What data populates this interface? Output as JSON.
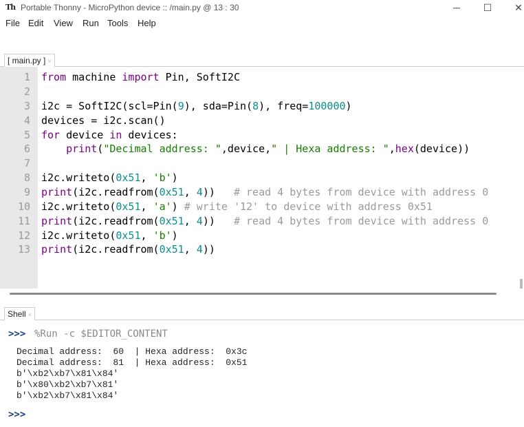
{
  "window": {
    "app_icon": "Th",
    "title": "Portable Thonny  -  MicroPython device :: /main.py  @  13 : 30",
    "minimize": "─",
    "maximize": "☐",
    "close": "✕"
  },
  "menu": [
    "File",
    "Edit",
    "View",
    "Run",
    "Tools",
    "Help"
  ],
  "editor_tab": {
    "label": "[ main.py ]",
    "close": "×"
  },
  "line_numbers": [
    "1",
    "2",
    "3",
    "4",
    "5",
    "6",
    "7",
    "8",
    "9",
    "10",
    "11",
    "12",
    "13"
  ],
  "code": {
    "l1": {
      "kw1": "from",
      "t1": " machine ",
      "kw2": "import",
      "t2": " Pin, SoftI2C"
    },
    "l3": {
      "t1": "i2c = SoftI2C(scl=Pin(",
      "n1": "9",
      "t2": "), sda=Pin(",
      "n2": "8",
      "t3": "), freq=",
      "n3": "100000",
      "t4": ")"
    },
    "l4": {
      "t1": "devices = i2c.scan()"
    },
    "l5": {
      "kw1": "for",
      "t1": " device ",
      "kw2": "in",
      "t2": " devices:"
    },
    "l6": {
      "indent": "    ",
      "kw1": "print",
      "t1": "(",
      "s1": "\"Decimal address: \"",
      "t2": ",device,",
      "s2": "\" | Hexa address: \"",
      "t3": ",",
      "kw2": "hex",
      "t4": "(device))"
    },
    "l8": {
      "t1": "i2c.writeto(",
      "n1": "0x51",
      "t2": ", ",
      "s1": "'b'",
      "t3": ")"
    },
    "l9": {
      "kw1": "print",
      "t1": "(i2c.readfrom(",
      "n1": "0x51",
      "t2": ", ",
      "n2": "4",
      "t3": "))   ",
      "c1": "# read 4 bytes from device with address 0"
    },
    "l10": {
      "t1": "i2c.writeto(",
      "n1": "0x51",
      "t2": ", ",
      "s1": "'a'",
      "t3": ") ",
      "c1": "# write '12' to device with address 0x51"
    },
    "l11": {
      "kw1": "print",
      "t1": "(i2c.readfrom(",
      "n1": "0x51",
      "t2": ", ",
      "n2": "4",
      "t3": "))   ",
      "c1": "# read 4 bytes from device with address 0"
    },
    "l12": {
      "t1": "i2c.writeto(",
      "n1": "0x51",
      "t2": ", ",
      "s1": "'b'",
      "t3": ")"
    },
    "l13": {
      "kw1": "print",
      "t1": "(i2c.readfrom(",
      "n1": "0x51",
      "t2": ", ",
      "n2": "4",
      "t3": "))"
    }
  },
  "shell_tab": {
    "label": "Shell",
    "close": "×"
  },
  "shell": {
    "prompt": ">>>",
    "run_command": "%Run -c $EDITOR_CONTENT",
    "output": [
      "Decimal address:  60  | Hexa address:  0x3c",
      "Decimal address:  81  | Hexa address:  0x51",
      "b'\\xb2\\xb7\\x81\\x84'",
      "b'\\x80\\xb2\\xb7\\x81'",
      "b'\\xb2\\xb7\\x81\\x84'"
    ],
    "final_prompt": ">>>"
  },
  "toolbar_icons": [
    "new-file-icon",
    "open-file-icon",
    "save-icon",
    "run-icon",
    "debug-icon",
    "step-over-icon",
    "step-into-icon",
    "step-out-icon",
    "resume-icon",
    "stop-icon",
    "ukraine-flag-icon"
  ],
  "colors": {
    "keyword": "#7a0086",
    "number": "#0b8f8a",
    "string": "#177d00",
    "comment": "#9a9a9a",
    "prompt": "#1b3c8c",
    "stop": "#d81b1b",
    "run": "#1e9e3a"
  }
}
